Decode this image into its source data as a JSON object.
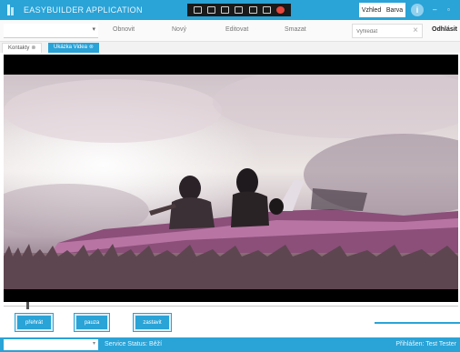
{
  "app": {
    "title": "EASYBUILDER APPLICATION",
    "brand_color": "#2aa3d7"
  },
  "title_bar": {
    "tools": [
      "layout-icon",
      "window-icon",
      "video-icon",
      "image-icon",
      "settings-icon",
      "expand-icon",
      "record-icon"
    ],
    "view_options": [
      "Vzhled",
      "Barva"
    ],
    "info_label": "i",
    "minimize_label": "–",
    "restore_label": "▫"
  },
  "toolbar": {
    "select_caret": "▾",
    "buttons": [
      "Obnovit",
      "Nový",
      "Editovat",
      "Smazat"
    ],
    "search": {
      "placeholder": "Vyhledat",
      "value": ""
    },
    "clear_label": "×",
    "logout_label": "Odhlásit"
  },
  "tabs": [
    {
      "label": "Kontakty",
      "close": "⊗",
      "active": false
    },
    {
      "label": "Ukázka Videa",
      "close": "⊗",
      "active": true
    }
  ],
  "player": {
    "progress": 0.05,
    "buttons": [
      "přehrát",
      "pauza",
      "zastavit"
    ]
  },
  "status_bar": {
    "select_caret": "▾",
    "service_status": "Service Status: Běží",
    "logged_in": "Přihlášen: Test Tester"
  }
}
